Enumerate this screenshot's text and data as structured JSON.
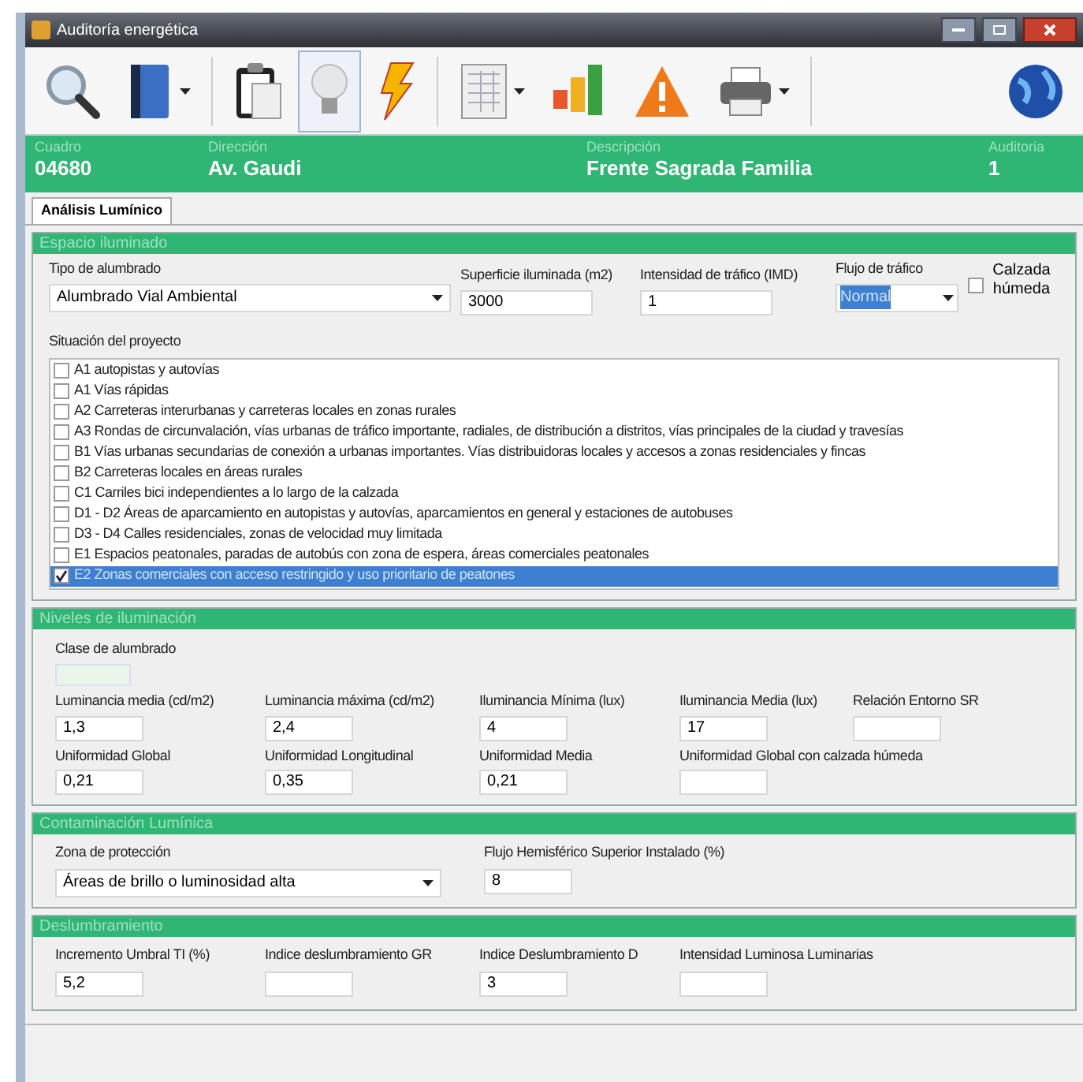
{
  "window": {
    "title": "Auditoría energética"
  },
  "toolbar": [
    {
      "selected": false,
      "dropdown": false
    },
    {
      "selected": false,
      "dropdown": true
    },
    {
      "selected": false,
      "dropdown": false
    },
    {
      "selected": true,
      "dropdown": false
    },
    {
      "selected": false,
      "dropdown": false
    },
    {
      "selected": false,
      "dropdown": true
    },
    {
      "selected": false,
      "dropdown": false
    },
    {
      "selected": false,
      "dropdown": false
    },
    {
      "selected": false,
      "dropdown": true
    },
    {
      "selected": false,
      "dropdown": false
    }
  ],
  "header": [
    {
      "label": "Cuadro",
      "value": "04680"
    },
    {
      "label": "Dirección",
      "value": "Av. Gaudi"
    },
    {
      "label": "Descripción",
      "value": "Frente Sagrada Familia"
    },
    {
      "label": "Auditoria",
      "value": "1"
    }
  ],
  "tabs": [
    {
      "label": "Análisis Lumínico",
      "selected": true
    }
  ],
  "espacio": {
    "title": "Espacio iluminado",
    "tipo": {
      "label": "Tipo de alumbrado",
      "value": "Alumbrado Vial Ambiental"
    },
    "superficie": {
      "label": "Superficie iluminada (m2)",
      "value": "3000"
    },
    "intensidad": {
      "label": "Intensidad de tráfico (IMD)",
      "value": "1"
    },
    "flujo": {
      "label": "Flujo de tráfico",
      "value": "Normal"
    },
    "calzada": {
      "label": "Calzada húmeda",
      "checked": false
    },
    "situacion_label": "Situación del proyecto",
    "situaciones": [
      {
        "label": "A1 autopistas y autovías",
        "checked": false,
        "selected": false
      },
      {
        "label": "A1 Vías rápidas",
        "checked": false,
        "selected": false
      },
      {
        "label": "A2 Carreteras interurbanas y carreteras locales en zonas rurales",
        "checked": false,
        "selected": false
      },
      {
        "label": "A3 Rondas de circunvalación, vías urbanas de tráfico importante, radiales, de distribución a distritos, vías principales de la ciudad y travesías",
        "checked": false,
        "selected": false
      },
      {
        "label": "B1 Vías urbanas secundarias de conexión a urbanas importantes. Vías distribuidoras locales y accesos a zonas residenciales y fincas",
        "checked": false,
        "selected": false
      },
      {
        "label": "B2 Carreteras locales en áreas rurales",
        "checked": false,
        "selected": false
      },
      {
        "label": "C1 Carriles bici independientes a lo largo de la calzada",
        "checked": false,
        "selected": false
      },
      {
        "label": "D1 - D2 Áreas de aparcamiento en autopistas y autovías, aparcamientos en general y estaciones de autobuses",
        "checked": false,
        "selected": false
      },
      {
        "label": "D3 - D4 Calles residenciales, zonas de velocidad muy limitada",
        "checked": false,
        "selected": false
      },
      {
        "label": "E1 Espacios peatonales, paradas de autobús con zona de espera, áreas comerciales peatonales",
        "checked": false,
        "selected": false
      },
      {
        "label": "E2 Zonas comerciales con acceso restringido y uso prioritario de peatones",
        "checked": true,
        "selected": true
      }
    ]
  },
  "niveles": {
    "title": "Niveles de iluminación",
    "clase_label": "Clase de alumbrado",
    "fields": [
      [
        {
          "label": "Luminancia media (cd/m2)",
          "value": "1,3"
        },
        {
          "label": "Luminancia máxima (cd/m2)",
          "value": "2,4"
        },
        {
          "label": "Iluminancia Mínima (lux)",
          "value": "4"
        },
        {
          "label": "Iluminancia Media (lux)",
          "value": "17"
        },
        {
          "label": "Relación Entorno SR"
        }
      ],
      [
        {
          "label": "Uniformidad Global",
          "value": "0,21"
        },
        {
          "label": "Uniformidad Longitudinal",
          "value": "0,35"
        },
        {
          "label": "Uniformidad Media",
          "value": "0,21"
        },
        {
          "label": "Uniformidad Global con calzada húmeda"
        }
      ]
    ]
  },
  "contaminacion": {
    "title": "Contaminación Lumínica",
    "zona": {
      "label": "Zona de protección",
      "value": "Áreas de brillo o luminosidad alta"
    },
    "flujo": {
      "label": "Flujo Hemisférico Superior Instalado (%)",
      "value": "8"
    }
  },
  "deslumbramiento": {
    "title": "Deslumbramiento",
    "fields": [
      {
        "label": "Incremento Umbral TI (%)",
        "value": "5,2"
      },
      {
        "label": "Indice deslumbramiento GR"
      },
      {
        "label": "Indice Deslumbramiento D",
        "value": "3"
      },
      {
        "label": "Intensidad Luminosa Luminarias"
      }
    ]
  }
}
